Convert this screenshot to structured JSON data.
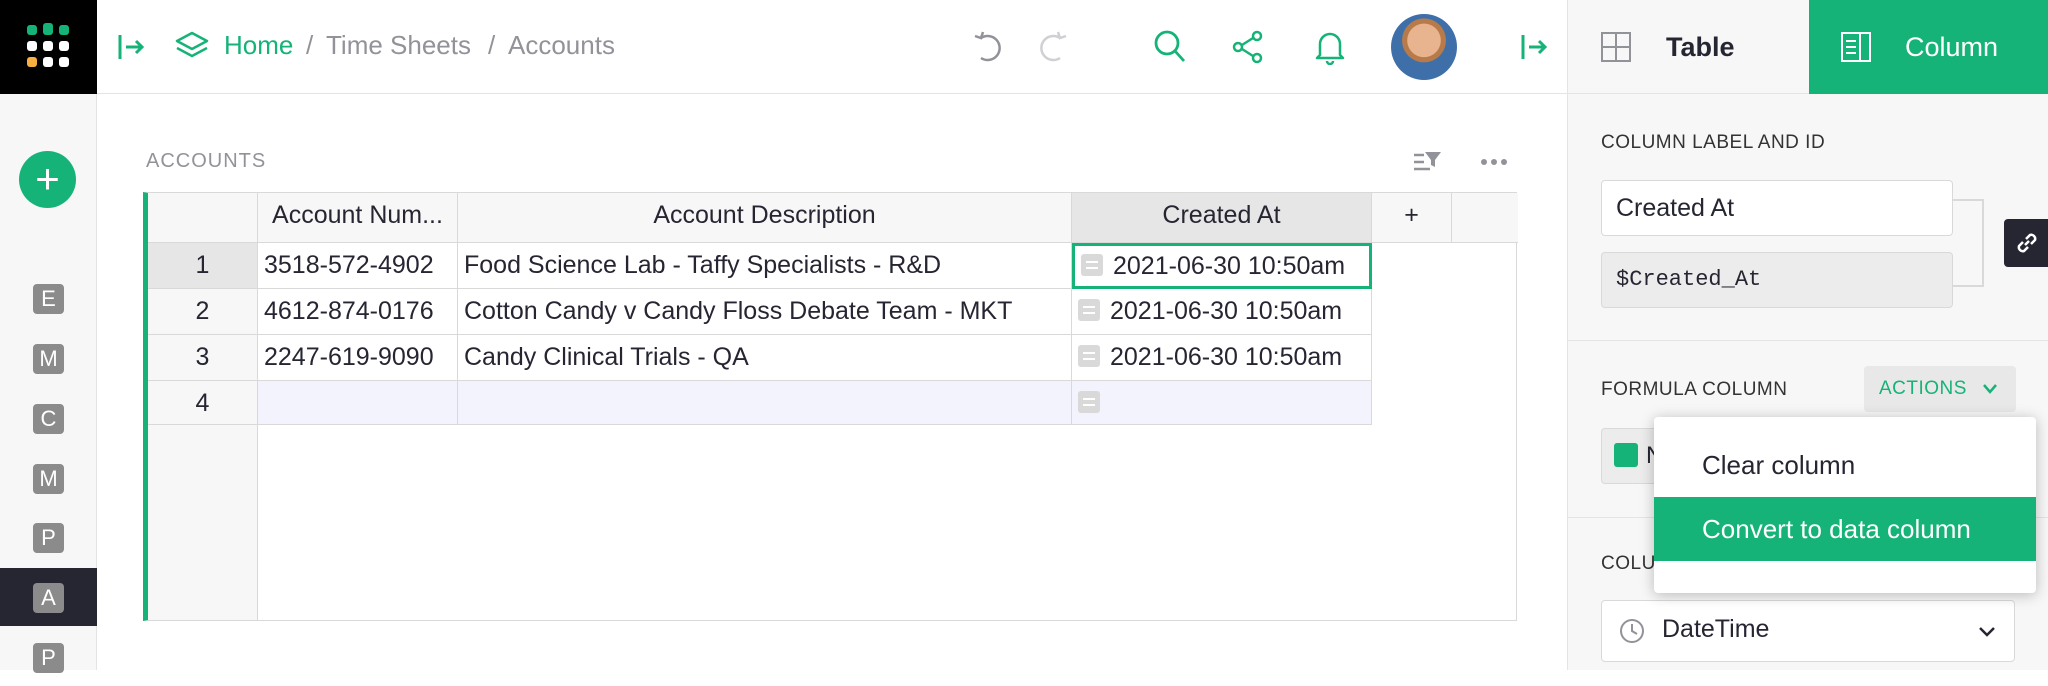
{
  "breadcrumb": {
    "home": "Home",
    "sep1": "/",
    "doc": "Time Sheets",
    "sep2": "/",
    "page": "Accounts"
  },
  "rail": {
    "add_label": "+",
    "items": [
      "E",
      "M",
      "C",
      "M",
      "P",
      "A",
      "P"
    ],
    "active_index": 5
  },
  "section": {
    "title": "ACCOUNTS"
  },
  "table": {
    "columns": [
      "Account Num...",
      "Account Description",
      "Created At"
    ],
    "add_column": "+",
    "rows": [
      {
        "num": "1",
        "acct": "3518-572-4902",
        "desc": "Food Science Lab - Taffy Specialists - R&D",
        "created": "2021-06-30 10:50am"
      },
      {
        "num": "2",
        "acct": "4612-874-0176",
        "desc": "Cotton Candy v Candy Floss Debate Team - MKT",
        "created": "2021-06-30 10:50am"
      },
      {
        "num": "3",
        "acct": "2247-619-9090",
        "desc": "Candy Clinical Trials - QA",
        "created": "2021-06-30 10:50am"
      },
      {
        "num": "4",
        "acct": "",
        "desc": "",
        "created": ""
      }
    ]
  },
  "panel": {
    "tab_table": "Table",
    "tab_column": "Column",
    "label_heading": "COLUMN LABEL AND ID",
    "label_value": "Created At",
    "id_value": "$Created_At",
    "formula_heading": "FORMULA COLUMN",
    "actions_label": "ACTIONS",
    "formula_partial": "N",
    "type_heading_partial": "COLU",
    "type_value": "DateTime"
  },
  "menu": {
    "items": [
      "Clear column",
      "Convert to data column"
    ],
    "selected_index": 1
  },
  "colors": {
    "accent": "#16b378",
    "dark": "#262633"
  }
}
